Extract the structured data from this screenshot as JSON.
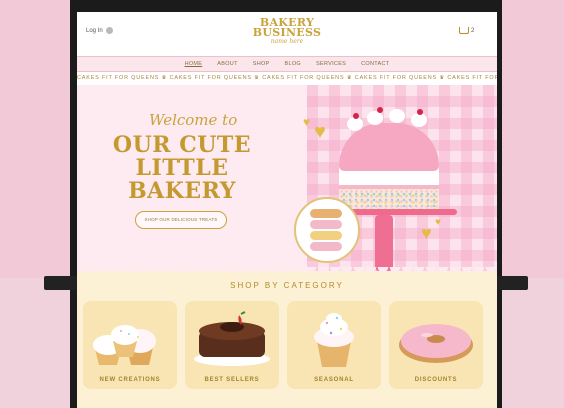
{
  "header": {
    "login_label": "Log In",
    "logo_line1": "BAKERY",
    "logo_line2": "BUSINESS",
    "logo_tagline": "name here",
    "cart_count": "2"
  },
  "nav": {
    "items": [
      {
        "label": "HOME",
        "active": true
      },
      {
        "label": "ABOUT"
      },
      {
        "label": "SHOP"
      },
      {
        "label": "BLOG"
      },
      {
        "label": "SERVICES"
      },
      {
        "label": "CONTACT"
      }
    ]
  },
  "ticker": {
    "text": "CAKES FIT FOR QUEENS ♛ CAKES FIT FOR QUEENS ♛ CAKES FIT FOR QUEENS ♛ CAKES FIT FOR QUEENS ♛ CAKES FIT FOR QUEENS ♛ CAKES FIT FOR QUEENS"
  },
  "hero": {
    "welcome": "Welcome to",
    "headline_1": "OUR CUTE",
    "headline_2": "LITTLE",
    "headline_3": "BAKERY",
    "cta_label": "SHOP OUR DELICIOUS TREATS"
  },
  "categories": {
    "title": "SHOP BY CATEGORY",
    "items": [
      {
        "label": "NEW CREATIONS",
        "icon": "cupcakes-photo"
      },
      {
        "label": "BEST SELLERS",
        "icon": "chocolate-cake-photo"
      },
      {
        "label": "SEASONAL",
        "icon": "cupcake-photo"
      },
      {
        "label": "DISCOUNTS",
        "icon": "donut-photo"
      }
    ]
  },
  "colors": {
    "gold": "#c9a23c",
    "pink": "#fdebf1",
    "cream": "#fcf1d4"
  }
}
